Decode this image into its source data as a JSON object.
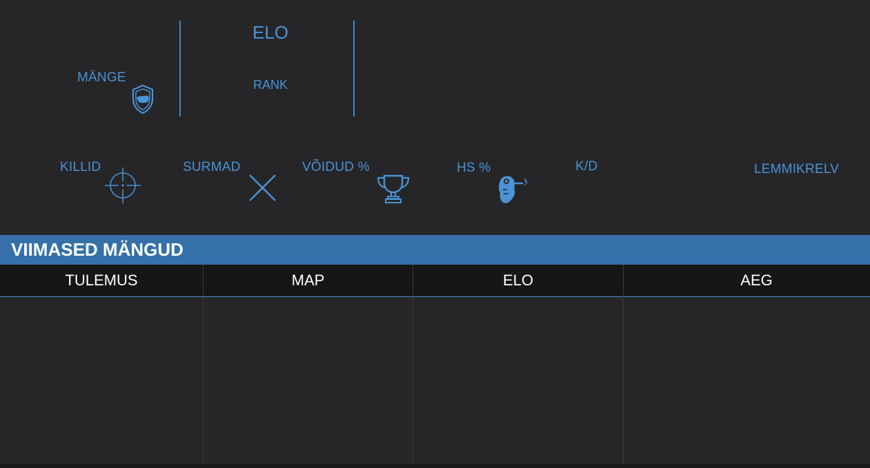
{
  "profile": {
    "games_label": "MÄNGE",
    "elo_label": "ELO",
    "rank_label": "RANK"
  },
  "stats": {
    "kills_label": "KILLID",
    "deaths_label": "SURMAD",
    "wins_label": "VÕIDUD %",
    "hs_label": "HS %",
    "kd_label": "K/D",
    "fav_weapon_label": "LEMMIKRELV"
  },
  "recent": {
    "title": "VIIMASED MÄNGUD",
    "columns": [
      "TULEMUS",
      "MAP",
      "ELO",
      "AEG"
    ],
    "rows": []
  },
  "icons": {
    "games": "shield-icon",
    "kills": "crosshair-icon",
    "deaths": "cross-icon",
    "wins": "trophy-icon",
    "hs": "headshot-icon"
  },
  "colors": {
    "accent": "#4a93d6",
    "section_bar": "#3571a8",
    "background": "#262628",
    "header_bg": "#161617"
  }
}
